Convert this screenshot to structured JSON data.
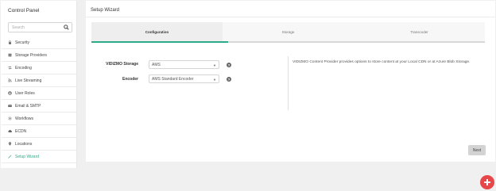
{
  "sidebar": {
    "title": "Control Panel",
    "search_placeholder": "Search",
    "items": [
      {
        "label": "Security",
        "icon": "lock-icon"
      },
      {
        "label": "Storage Providers",
        "icon": "storage-icon"
      },
      {
        "label": "Encoding",
        "icon": "encoding-icon"
      },
      {
        "label": "Live Streaming",
        "icon": "rss-icon"
      },
      {
        "label": "User Roles",
        "icon": "user-icon"
      },
      {
        "label": "Email & SMTP",
        "icon": "envelope-icon"
      },
      {
        "label": "Workflows",
        "icon": "gear-icon"
      },
      {
        "label": "ECDN",
        "icon": "cloud-icon"
      },
      {
        "label": "Locations",
        "icon": "map-marker-icon"
      },
      {
        "label": "Setup Wizard",
        "icon": "magic-wand-icon",
        "active": true
      }
    ]
  },
  "main": {
    "title": "Setup Wizard",
    "steps": [
      {
        "label": "Configuration",
        "active": true
      },
      {
        "label": "Storage",
        "active": false
      },
      {
        "label": "Transcoder",
        "active": false
      }
    ],
    "progress_fraction": 0.333,
    "form": {
      "storage_label": "VIDIZMO Storage",
      "storage_value": "AMS",
      "encoder_label": "Encoder",
      "encoder_value": "AMS Standard Encoder"
    },
    "info_text": "VIDIZMO Content Provider provides options to store content at your Local CDN or at Azure Blob Storage.",
    "next_label": "Next"
  },
  "colors": {
    "accent": "#2bab88",
    "fab": "#e8474a",
    "page_bg": "#f0f0f0"
  }
}
